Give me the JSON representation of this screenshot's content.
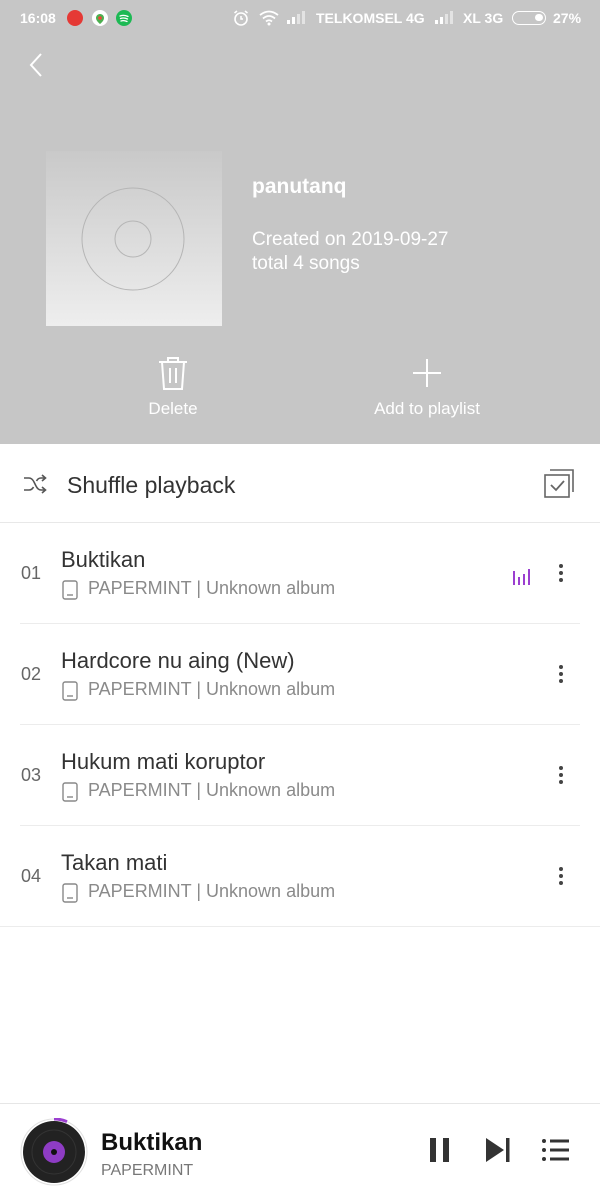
{
  "status_bar": {
    "time": "16:08",
    "carrier1": "TELKOMSEL 4G",
    "carrier2": "XL 3G",
    "battery": "27%"
  },
  "playlist": {
    "name": "panutanq",
    "created": "Created on 2019-09-27",
    "total": "total 4 songs"
  },
  "actions": {
    "delete": "Delete",
    "add_to_playlist": "Add to playlist"
  },
  "shuffle": {
    "label": "Shuffle playback"
  },
  "songs": [
    {
      "num": "01",
      "title": "Buktikan",
      "meta": "PAPERMINT | Unknown album",
      "playing": true
    },
    {
      "num": "02",
      "title": "Hardcore nu aing (New)",
      "meta": "PAPERMINT | Unknown album",
      "playing": false
    },
    {
      "num": "03",
      "title": "Hukum mati koruptor",
      "meta": "PAPERMINT | Unknown album",
      "playing": false
    },
    {
      "num": "04",
      "title": "Takan mati",
      "meta": "PAPERMINT | Unknown album",
      "playing": false
    }
  ],
  "player": {
    "title": "Buktikan",
    "artist": "PAPERMINT"
  },
  "colors": {
    "header_bg": "#c6c6c6",
    "accent": "#9b3fd0"
  }
}
